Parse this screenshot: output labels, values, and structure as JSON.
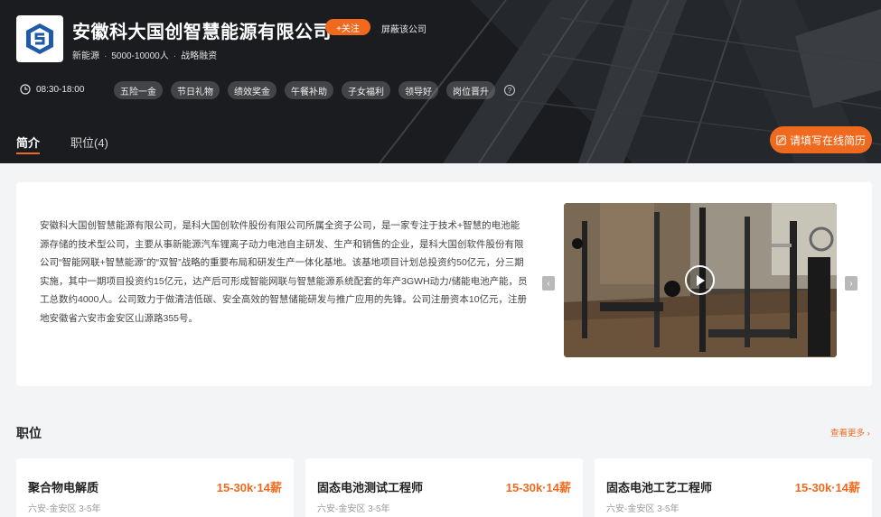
{
  "company": {
    "name": "安徽科大国创智慧能源有限公司",
    "follow_label": "+关注",
    "block_label": "屏蔽该公司",
    "industry": "新能源",
    "size": "5000-10000人",
    "financing": "战略融资",
    "hours": "08:30-18:00",
    "benefits": [
      "五险一金",
      "节日礼物",
      "绩效奖金",
      "午餐补助",
      "子女福利",
      "领导好",
      "岗位晋升"
    ],
    "help_symbol": "?"
  },
  "tabs": {
    "intro": "简介",
    "jobs": "职位(4)"
  },
  "resume_button": "请填写在线简历",
  "intro": {
    "text": "安徽科大国创智慧能源有限公司，是科大国创软件股份有限公司所属全资子公司，是一家专注于技术+智慧的电池能源存储的技术型公司，主要从事新能源汽车锂离子动力电池自主研发、生产和销售的企业，是科大国创软件股份有限公司“智能网联+智慧能源”的“双智”战略的重要布局和研发生产一体化基地。该基地项目计划总投资约50亿元，分三期实施，其中一期项目投资约15亿元，达产后可形成智能网联与智慧能源系统配套的年产3GWH动力/储能电池产能，员工总数约4000人。公司致力于做清洁低碳、安全高效的智慧储能研发与推广应用的先锋。公司注册资本10亿元，注册地安徽省六安市金安区山源路355号。",
    "prev_arrow": "‹",
    "next_arrow": "›"
  },
  "jobs_section": {
    "title": "职位",
    "more": "查看更多 ›",
    "items": [
      {
        "title": "聚合物电解质",
        "salary": "15-30k·14薪",
        "location": "六安-金安区 3-5年"
      },
      {
        "title": "固态电池测试工程师",
        "salary": "15-30k·14薪",
        "location": "六安-金安区 3-5年"
      },
      {
        "title": "固态电池工艺工程师",
        "salary": "15-30k·14薪",
        "location": "六安-金安区 3-5年"
      }
    ]
  },
  "colors": {
    "accent": "#ef6a1f",
    "banner": "#17191c",
    "page_bg": "#f3f4f6"
  },
  "icons": [
    "company-logo-icon",
    "clock-icon",
    "question-icon",
    "edit-icon",
    "play-icon",
    "chevron-left-icon",
    "chevron-right-icon"
  ]
}
